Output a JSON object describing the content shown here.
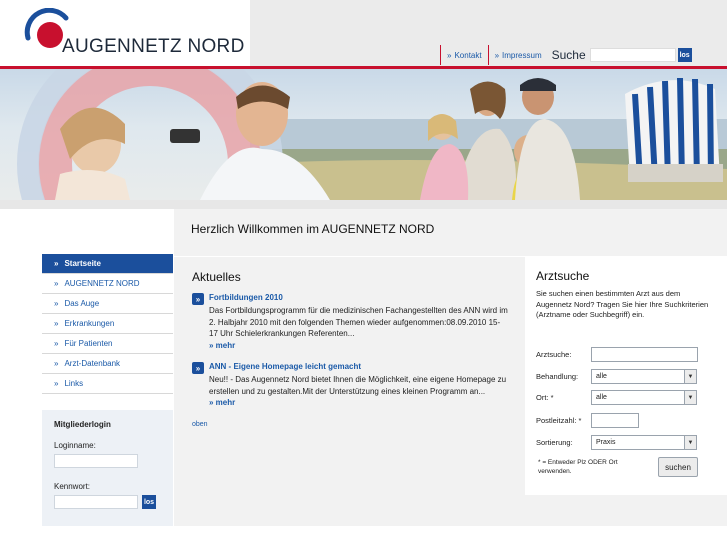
{
  "header": {
    "logo_text": "AUGENNETZ NORD",
    "nav": [
      {
        "label": "Kontakt"
      },
      {
        "label": "Impressum"
      }
    ],
    "search_label": "Suche",
    "search_placeholder": "",
    "search_button": "los"
  },
  "main": {
    "page_title": "Herzlich Willkommen im AUGENNETZ NORD"
  },
  "sidebar": {
    "items": [
      {
        "label": "Startseite",
        "active": true
      },
      {
        "label": "AUGENNETZ NORD"
      },
      {
        "label": "Das Auge"
      },
      {
        "label": "Erkrankungen"
      },
      {
        "label": "Für Patienten"
      },
      {
        "label": "Arzt-Datenbank"
      },
      {
        "label": "Links"
      }
    ],
    "chevron": "»"
  },
  "login": {
    "title": "Mitgliederlogin",
    "user_label": "Loginname:",
    "pass_label": "Kennwort:",
    "button": "los"
  },
  "news": {
    "title": "Aktuelles",
    "items": [
      {
        "headline": "Fortbildungen 2010",
        "body": "Das Fortbildungsprogramm für die medizinischen Fachangestellten des ANN wird im 2. Halbjahr 2010 mit den folgenden Themen wieder aufgenommen:08.09.2010 15-17 Uhr Schielerkrankungen Referenten...",
        "more": "» mehr"
      },
      {
        "headline": "ANN - Eigene Homepage leicht gemacht",
        "body": "Neu!! - Das Augennetz Nord bietet Ihnen die Möglichkeit, eine eigene Homepage zu erstellen und zu gestalten.Mit der Unterstützung eines kleinen Programm an...",
        "more": "» mehr"
      }
    ],
    "arrow_icon": "»",
    "top_link": "oben"
  },
  "arztsuche": {
    "title": "Arztsuche",
    "description": "Sie suchen einen bestimmten Arzt aus dem Augennetz Nord? Tragen Sie hier Ihre Suchkriterien (Arztname oder Suchbegriff) ein.",
    "fields": {
      "arztsuche_label": "Arztsuche:",
      "arztsuche_value": "",
      "behandlung_label": "Behandlung:",
      "behandlung_value": "alle",
      "ort_label": "Ort: *",
      "ort_value": "alle",
      "plz_label": "Postleitzahl: *",
      "plz_value": "",
      "sortierung_label": "Sortierung:",
      "sortierung_value": "Praxis"
    },
    "hint": "* = Entweder Plz ODER Ort verwenden.",
    "button": "suchen"
  },
  "colors": {
    "brand_blue": "#1b4f9c",
    "link_blue": "#1b5aa8",
    "accent_red": "#c8102e"
  }
}
